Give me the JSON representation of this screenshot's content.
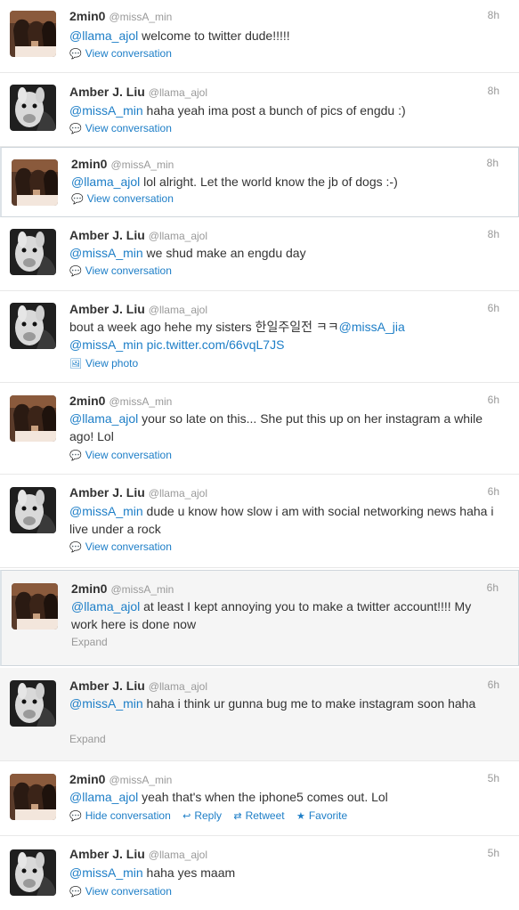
{
  "icons": {
    "conversation": "💬",
    "photo": "🖼",
    "reply": "↩",
    "retweet": "⇄",
    "favorite": "★"
  },
  "tweets": [
    {
      "name": "2min0",
      "handle": "@missA_min",
      "time": "8h",
      "mention": "@llama_ajol",
      "text": " welcome to twitter dude!!!!!",
      "action": "View conversation",
      "avatar": "group"
    },
    {
      "name": "Amber J. Liu",
      "handle": "@llama_ajol",
      "time": "8h",
      "mention": "@missA_min",
      "text": " haha yeah ima post a bunch of pics of engdu :)",
      "action": "View conversation",
      "avatar": "llama"
    },
    {
      "name": "2min0",
      "handle": "@missA_min",
      "time": "8h",
      "mention": "@llama_ajol",
      "text": " lol alright. Let the world know the jb of dogs :-)",
      "action": "View conversation",
      "avatar": "group"
    },
    {
      "name": "Amber J. Liu",
      "handle": "@llama_ajol",
      "time": "8h",
      "mention": "@missA_min",
      "text": " we shud make an engdu day",
      "action": "View conversation",
      "avatar": "llama"
    },
    {
      "name": "Amber J. Liu",
      "handle": "@llama_ajol",
      "time": "6h",
      "text_pre": "bout a week ago hehe my sisters 한일주일전 ㅋㅋ",
      "mention_a": "@missA_jia",
      "mention_b": "@missA_min",
      "link": "pic.twitter.com/66vqL7JS",
      "action": "View photo",
      "avatar": "llama"
    },
    {
      "name": "2min0",
      "handle": "@missA_min",
      "time": "6h",
      "mention": "@llama_ajol",
      "text": " your so late on this... She put this up on her instagram a while ago! Lol",
      "action": "View conversation",
      "avatar": "group"
    },
    {
      "name": "Amber J. Liu",
      "handle": "@llama_ajol",
      "time": "6h",
      "mention": "@missA_min",
      "text": " dude u know how slow i am with social networking news haha i live under a rock",
      "action": "View conversation",
      "avatar": "llama"
    },
    {
      "name": "2min0",
      "handle": "@missA_min",
      "time": "6h",
      "mention": "@llama_ajol",
      "text": " at least I kept annoying you to make a twitter account!!!! My work here is done now",
      "action": "Expand",
      "avatar": "group"
    },
    {
      "name": "Amber J. Liu",
      "handle": "@llama_ajol",
      "time": "6h",
      "mention": "@missA_min",
      "text": " haha i think ur gunna bug me to make instagram soon haha",
      "action": "Expand",
      "avatar": "llama"
    },
    {
      "name": "2min0",
      "handle": "@missA_min",
      "time": "5h",
      "mention": "@llama_ajol",
      "text": " yeah that's when the iphone5 comes out. Lol",
      "actions": {
        "hide": "Hide conversation",
        "reply": "Reply",
        "retweet": "Retweet",
        "favorite": "Favorite"
      },
      "avatar": "group"
    },
    {
      "name": "Amber J. Liu",
      "handle": "@llama_ajol",
      "time": "5h",
      "mention": "@missA_min",
      "text": " haha yes maam",
      "action": "View conversation",
      "avatar": "llama"
    }
  ]
}
